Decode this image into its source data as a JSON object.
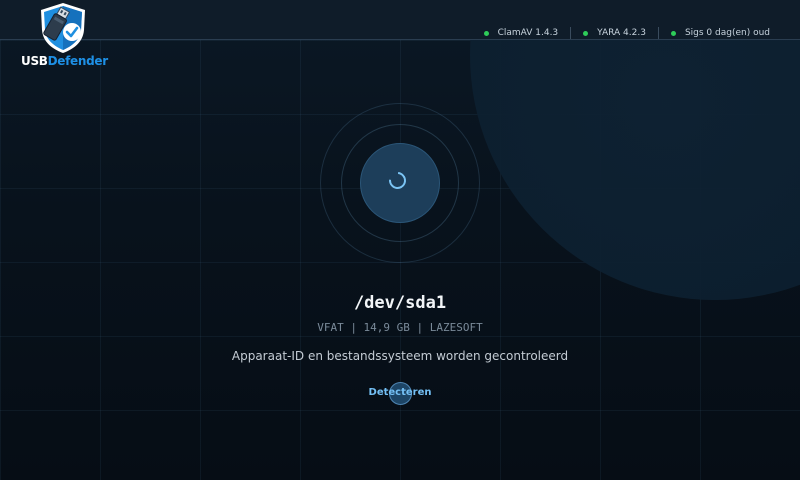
{
  "app": {
    "logo_usb": "USB",
    "logo_defender": "Defender"
  },
  "status": [
    {
      "label": "ClamAV 1.4.3",
      "state_color": "#2ecc59"
    },
    {
      "label": "YARA 4.2.3",
      "state_color": "#2ecc59"
    },
    {
      "label": "Sigs 0 dag(en) oud",
      "state_color": "#2ecc59"
    }
  ],
  "device": {
    "path": "/dev/sda1",
    "meta": "VFAT | 14,9 GB | LAZESOFT",
    "message": "Apparaat-ID en bestandssysteem worden gecontroleerd",
    "phase": "Detecteren"
  },
  "colors": {
    "accent": "#1e90e6",
    "ok": "#2ecc59",
    "phase_text": "#74c0f5"
  },
  "icons": {
    "logo": "shield-usb-check-icon",
    "spinner": "loading-spinner-icon"
  }
}
